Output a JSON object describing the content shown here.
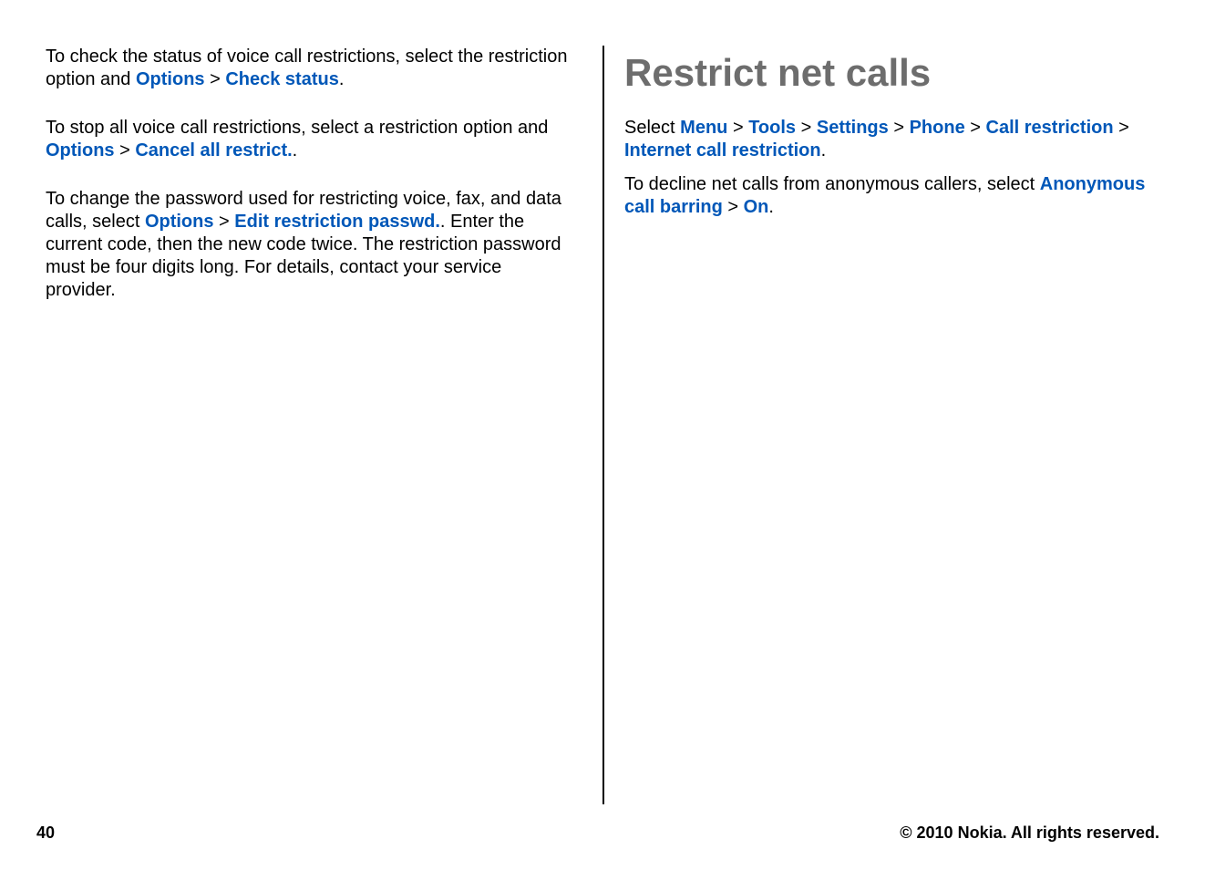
{
  "left": {
    "p1_a": "To check the status of voice call restrictions, select the restriction option and ",
    "p1_k1": "Options",
    "p1_k2": "Check status",
    "p2_a": "To stop all voice call restrictions, select a restriction option and ",
    "p2_k1": "Options",
    "p2_k2": "Cancel all restrict.",
    "p3_a": "To change the password used for restricting voice, fax, and data calls, select ",
    "p3_k1": "Options",
    "p3_k2": "Edit restriction passwd.",
    "p3_b": ". Enter the current code, then the new code twice. The restriction password must be four digits long. For details, contact your service provider."
  },
  "right": {
    "heading": "Restrict net calls",
    "p1_a": "Select ",
    "p1_k1": "Menu",
    "p1_k2": "Tools",
    "p1_k3": "Settings",
    "p1_k4": "Phone",
    "p1_k5": "Call restriction",
    "p1_k6": "Internet call restriction",
    "p2_a": "To decline net calls from anonymous callers, select ",
    "p2_k1": "Anonymous call barring",
    "p2_k2": "On"
  },
  "sep": ">",
  "period": ".",
  "footer": {
    "page": "40",
    "copyright": "© 2010 Nokia. All rights reserved."
  }
}
